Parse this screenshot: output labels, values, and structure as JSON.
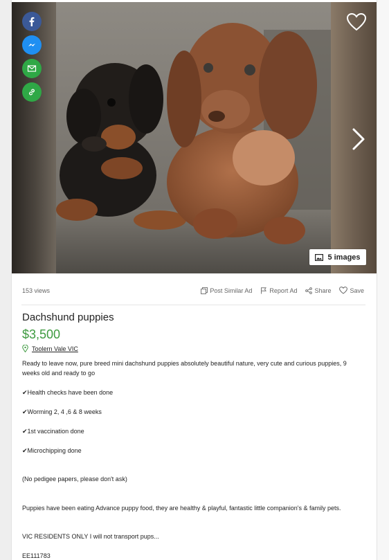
{
  "gallery": {
    "image_count_label": "5 images",
    "social": [
      {
        "icon": "facebook-icon",
        "color": "#3b5998"
      },
      {
        "icon": "messenger-icon",
        "color": "#1f8ff2"
      },
      {
        "icon": "email-icon",
        "color": "#2fa846"
      },
      {
        "icon": "link-icon",
        "color": "#2fa846"
      }
    ]
  },
  "meta": {
    "views": "153 views",
    "actions": {
      "post_similar": "Post Similar Ad",
      "report": "Report Ad",
      "share": "Share",
      "save": "Save"
    }
  },
  "listing": {
    "title": "Dachshund puppies",
    "price": "$3,500",
    "price_color": "#3d9a3f",
    "location": "Toolern Vale VIC",
    "description": [
      "Ready to leave now, pure breed mini dachshund puppies absolutely beautiful nature, very cute and curious puppies, 9 weeks old and ready to go",
      "✔Health checks have been done",
      "✔Worming 2, 4 ,6 & 8 weeks",
      "✔1st vaccination done",
      "✔Microchipping done",
      "(No pedigee papers, please don't ask)",
      "Puppies have been eating Advance puppy food, they are healthy & playful, fantastic little companion's & family pets.",
      "VIC RESIDENTS ONLY I will not transport pups...",
      "EE111783"
    ]
  }
}
